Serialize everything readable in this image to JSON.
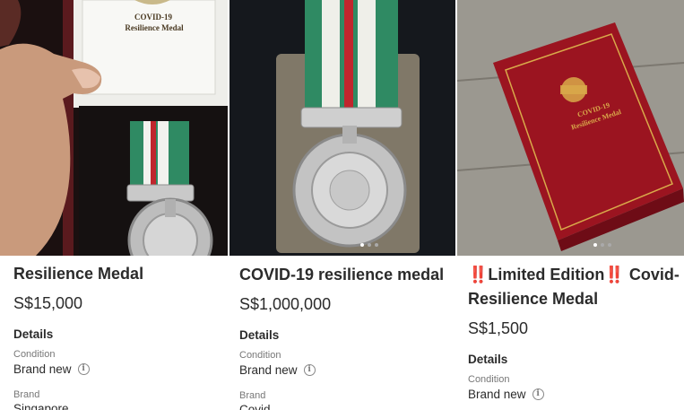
{
  "listings": [
    {
      "title": "Resilience Medal",
      "price": "S$15,000",
      "details_heading": "Details",
      "condition_label": "Condition",
      "condition_value": "Brand new",
      "brand_label": "Brand",
      "brand_value": "Singapore",
      "box_text_line1": "COVID-19",
      "box_text_line2": "Resilience Medal"
    },
    {
      "title": "COVID-19 resilience medal",
      "price": "S$1,000,000",
      "details_heading": "Details",
      "condition_label": "Condition",
      "condition_value": "Brand new",
      "brand_label": "Brand",
      "brand_value": "Covid"
    },
    {
      "title_prefix": "‼️",
      "title_line1": "Limited Edition",
      "title_mid": "‼️",
      "title_line1_end": " Covid-",
      "title_line2": "Resilience Medal",
      "price": "S$1,500",
      "details_heading": "Details",
      "condition_label": "Condition",
      "condition_value": "Brand new",
      "box_text_line1": "COVID-19",
      "box_text_line2": "Resilience Medal"
    }
  ],
  "info_glyph": "i",
  "colors": {
    "ribbon_green": "#2f8a63",
    "ribbon_red": "#c0262d",
    "box_red": "#9b1420",
    "gold": "#d9a94a"
  }
}
